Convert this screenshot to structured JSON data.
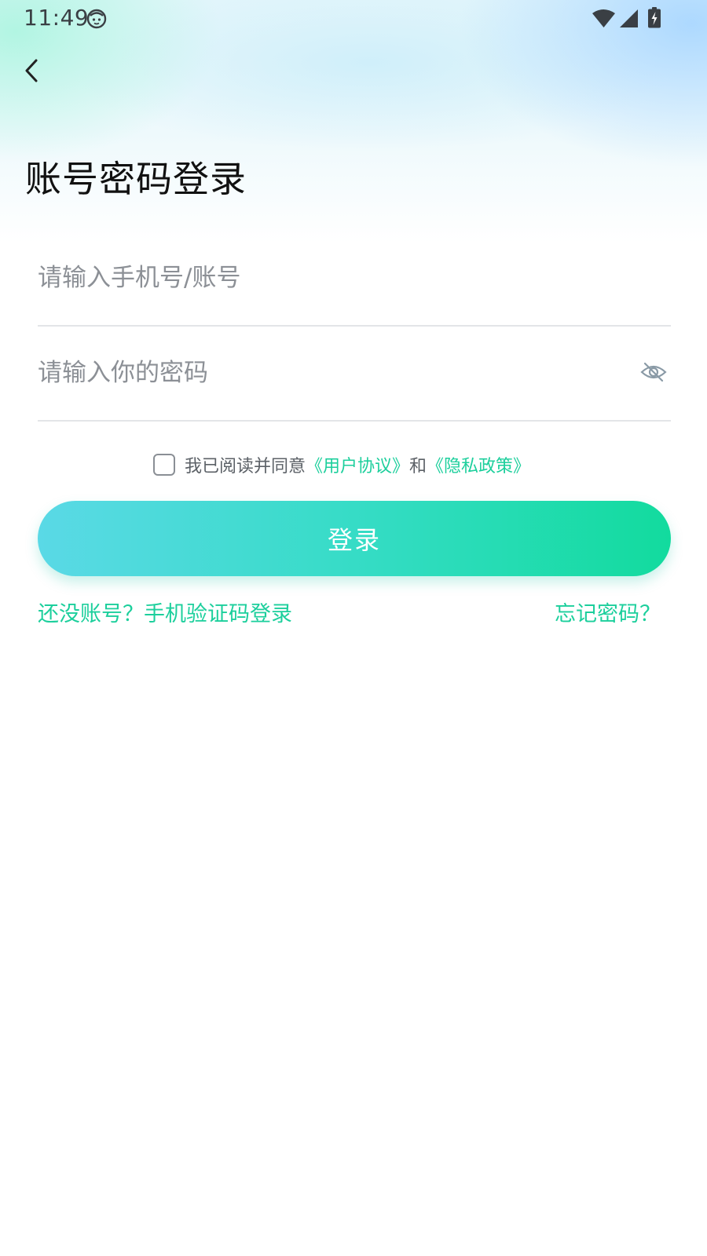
{
  "status_bar": {
    "time": "11:49",
    "face_icon": "face-icon",
    "wifi_icon": "wifi-icon",
    "signal_icon": "signal-icon",
    "battery_icon": "battery-charging-icon"
  },
  "header": {
    "back_icon": "chevron-left-icon",
    "title": "账号密码登录"
  },
  "form": {
    "account_placeholder": "请输入手机号/账号",
    "account_value": "",
    "password_placeholder": "请输入你的密码",
    "password_value": "",
    "eye_icon": "eye-off-icon"
  },
  "agreement": {
    "checked": false,
    "prefix": "我已阅读并同意",
    "user_agreement": "《用户协议》",
    "conjunction": "和",
    "privacy_policy": "《隐私政策》"
  },
  "actions": {
    "login_label": "登录",
    "sms_login_link": "还没账号？手机验证码登录",
    "forgot_password_link": "忘记密码？"
  },
  "colors": {
    "accent": "#1ccf9c",
    "button_gradient_start": "#5ad9e6",
    "button_gradient_end": "#12db9e",
    "title": "#111111",
    "placeholder": "#8c9096"
  }
}
